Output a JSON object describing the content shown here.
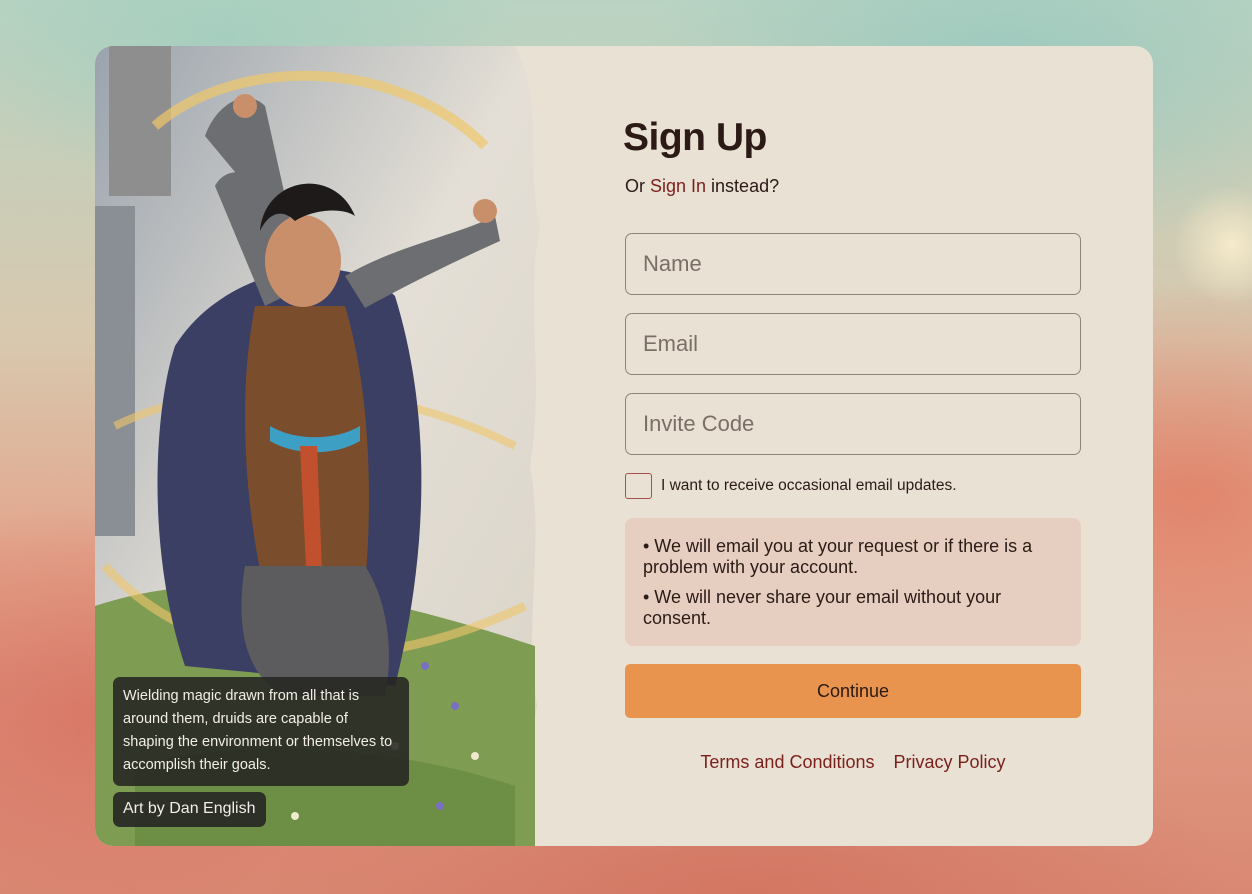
{
  "art": {
    "caption": "Wielding magic drawn from all that is around them, druids are capable of shaping the environment or themselves to accomplish their goals.",
    "credit": "Art by Dan English"
  },
  "form": {
    "title": "Sign Up",
    "subtitle_prefix": "Or ",
    "signin_link": "Sign In",
    "subtitle_suffix": " instead?",
    "name_placeholder": "Name",
    "email_placeholder": "Email",
    "invite_placeholder": "Invite Code",
    "updates_label": "I want to receive occasional email updates.",
    "updates_checked": false,
    "info_points": [
      "•  We will email you at your request or if there is a problem with your account.",
      "•  We will never share your email without your consent."
    ],
    "continue_label": "Continue",
    "terms_link": "Terms and Conditions",
    "privacy_link": "Privacy Policy"
  },
  "colors": {
    "card_bg": "#e9e1d4",
    "accent": "#e8944e",
    "link": "#7a1f1a",
    "info_bg": "#e6cfc0"
  }
}
